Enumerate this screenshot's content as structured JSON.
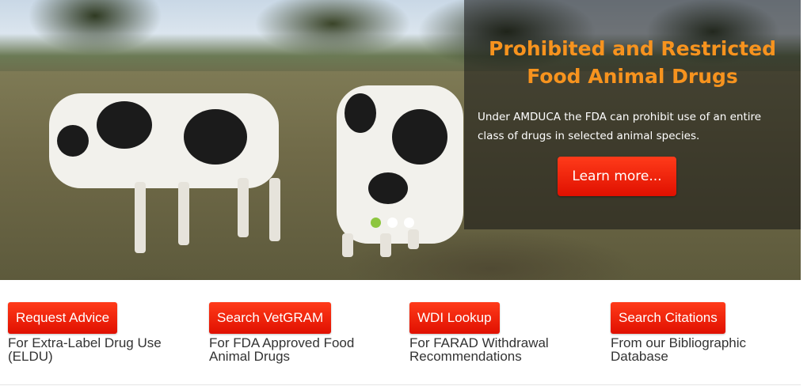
{
  "hero": {
    "title": "Prohibited and Restricted\nFood Animal Drugs",
    "text": "Under AMDUCA the FDA can prohibit use of an entire class of drugs in selected animal species.",
    "button_label": "Learn more...",
    "slides": 3,
    "active_slide": 1,
    "colors": {
      "title": "#f7931e",
      "button": "#e8210b",
      "active_dot": "#8dc63f"
    }
  },
  "cards": [
    {
      "button_label": "Request Advice",
      "description": "For Extra-Label Drug Use\n(ELDU)"
    },
    {
      "button_label": "Search VetGRAM",
      "description": "For FDA Approved Food\nAnimal Drugs"
    },
    {
      "button_label": "WDI Lookup",
      "description": "For FARAD Withdrawal\nRecommendations"
    },
    {
      "button_label": "Search Citations",
      "description": "From our Bibliographic\nDatabase"
    }
  ]
}
